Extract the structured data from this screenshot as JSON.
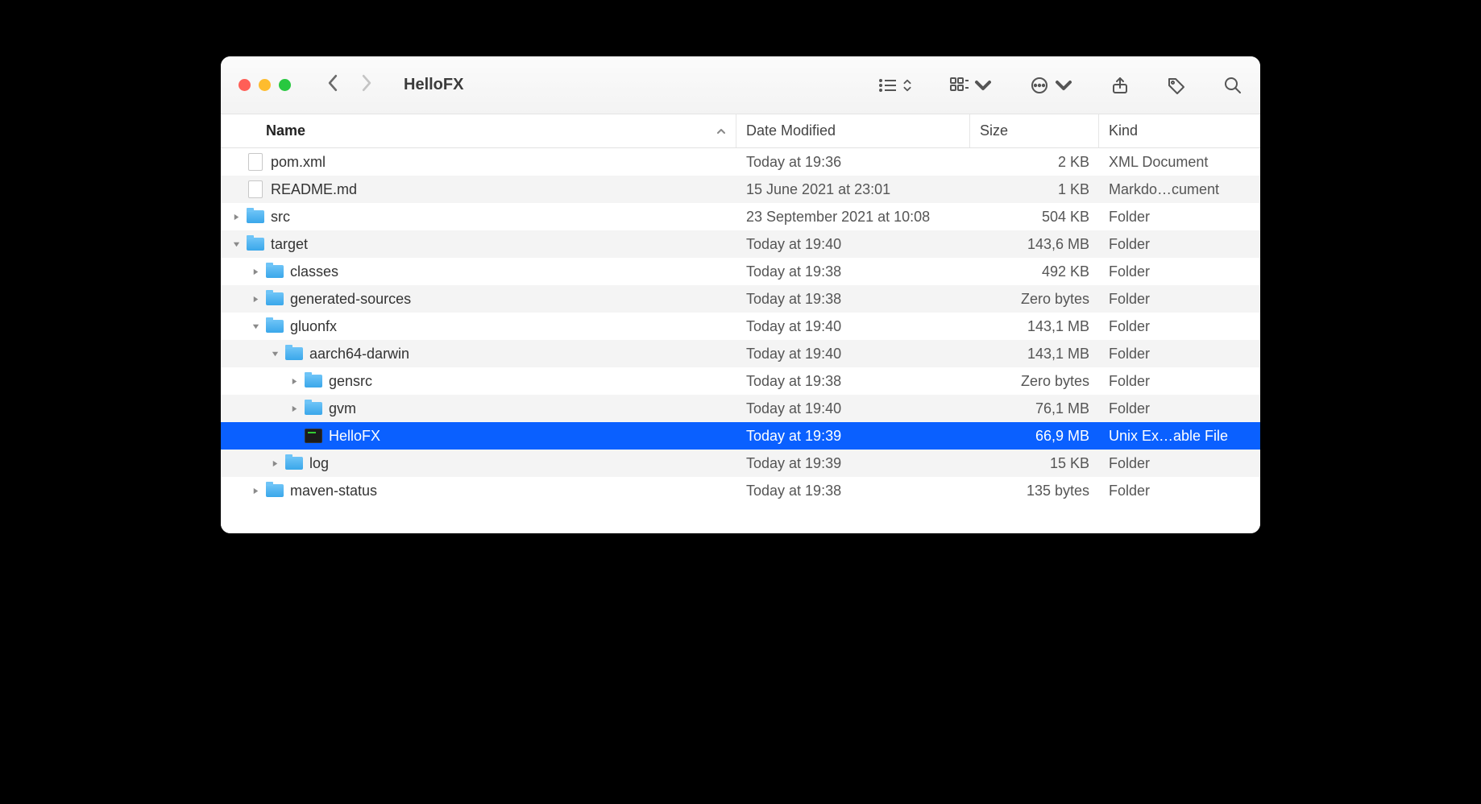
{
  "window": {
    "title": "HelloFX"
  },
  "columns": {
    "name": "Name",
    "date": "Date Modified",
    "size": "Size",
    "kind": "Kind"
  },
  "rows": [
    {
      "indent": 0,
      "disclosure": "none",
      "icon": "doc",
      "name": "pom.xml",
      "date": "Today at 19:36",
      "size": "2 KB",
      "kind": "XML Document",
      "selected": false
    },
    {
      "indent": 0,
      "disclosure": "none",
      "icon": "doc",
      "name": "README.md",
      "date": "15 June 2021 at 23:01",
      "size": "1 KB",
      "kind": "Markdo…cument",
      "selected": false
    },
    {
      "indent": 0,
      "disclosure": "right",
      "icon": "folder",
      "name": "src",
      "date": "23 September 2021 at 10:08",
      "size": "504 KB",
      "kind": "Folder",
      "selected": false
    },
    {
      "indent": 0,
      "disclosure": "down",
      "icon": "folder",
      "name": "target",
      "date": "Today at 19:40",
      "size": "143,6 MB",
      "kind": "Folder",
      "selected": false
    },
    {
      "indent": 1,
      "disclosure": "right",
      "icon": "folder",
      "name": "classes",
      "date": "Today at 19:38",
      "size": "492 KB",
      "kind": "Folder",
      "selected": false
    },
    {
      "indent": 1,
      "disclosure": "right",
      "icon": "folder",
      "name": "generated-sources",
      "date": "Today at 19:38",
      "size": "Zero bytes",
      "kind": "Folder",
      "selected": false
    },
    {
      "indent": 1,
      "disclosure": "down",
      "icon": "folder",
      "name": "gluonfx",
      "date": "Today at 19:40",
      "size": "143,1 MB",
      "kind": "Folder",
      "selected": false
    },
    {
      "indent": 2,
      "disclosure": "down",
      "icon": "folder",
      "name": "aarch64-darwin",
      "date": "Today at 19:40",
      "size": "143,1 MB",
      "kind": "Folder",
      "selected": false
    },
    {
      "indent": 3,
      "disclosure": "right",
      "icon": "folder",
      "name": "gensrc",
      "date": "Today at 19:38",
      "size": "Zero bytes",
      "kind": "Folder",
      "selected": false
    },
    {
      "indent": 3,
      "disclosure": "right",
      "icon": "folder",
      "name": "gvm",
      "date": "Today at 19:40",
      "size": "76,1 MB",
      "kind": "Folder",
      "selected": false
    },
    {
      "indent": 3,
      "disclosure": "none",
      "icon": "exec",
      "name": "HelloFX",
      "date": "Today at 19:39",
      "size": "66,9 MB",
      "kind": "Unix Ex…able File",
      "selected": true
    },
    {
      "indent": 2,
      "disclosure": "right",
      "icon": "folder",
      "name": "log",
      "date": "Today at 19:39",
      "size": "15 KB",
      "kind": "Folder",
      "selected": false
    },
    {
      "indent": 1,
      "disclosure": "right",
      "icon": "folder",
      "name": "maven-status",
      "date": "Today at 19:38",
      "size": "135 bytes",
      "kind": "Folder",
      "selected": false
    }
  ]
}
